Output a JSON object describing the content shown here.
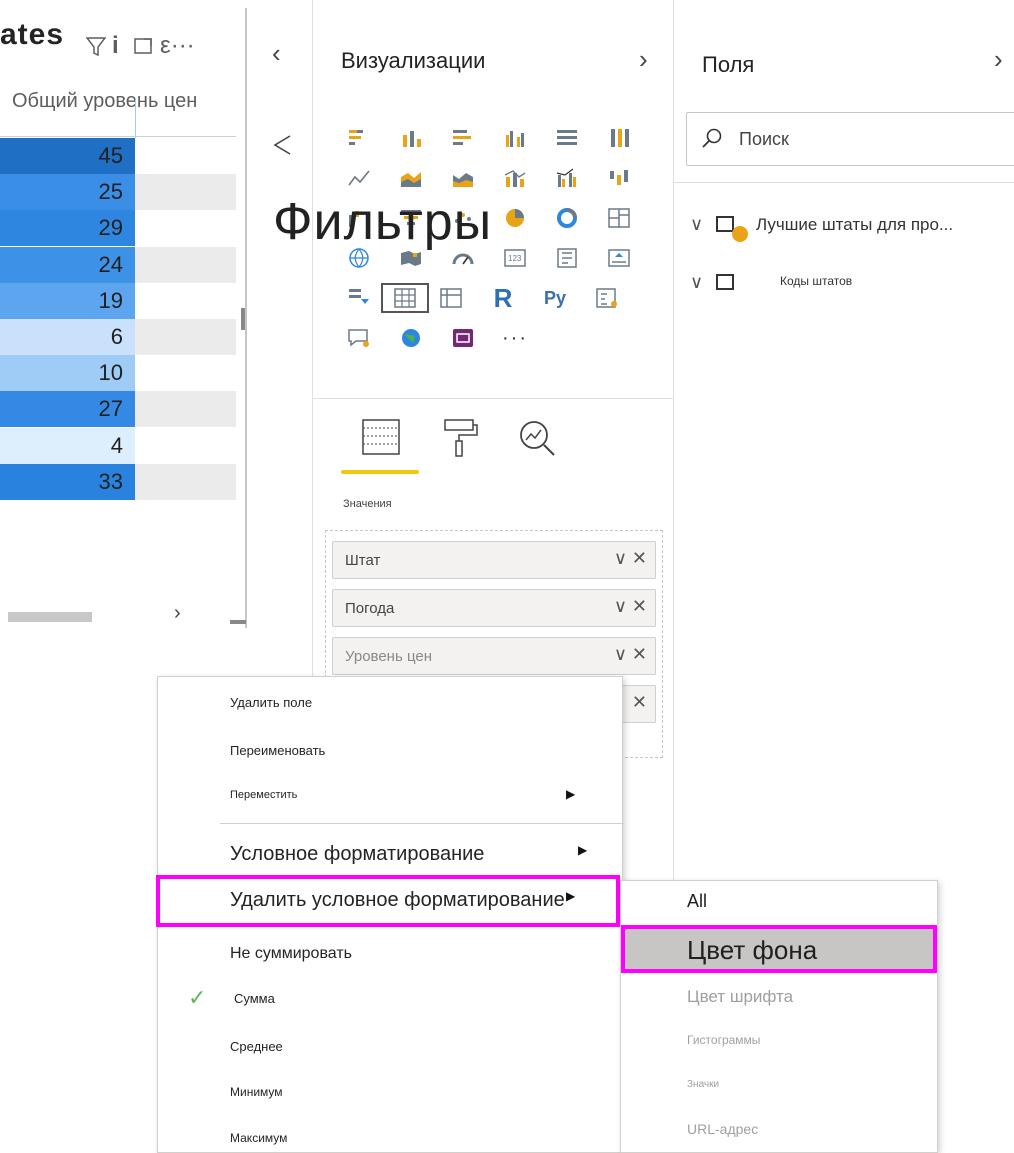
{
  "table_visual": {
    "title": "ates",
    "title_icons": [
      "filter-icon",
      "info-icon",
      "focus-mode-icon",
      "more-options-icon"
    ],
    "column_header": "Общий уровень цен",
    "rows": [
      {
        "value": "45",
        "color": "#1f6fc5"
      },
      {
        "value": "25",
        "color": "#3a8ee6"
      },
      {
        "value": "29",
        "color": "#2f86e0"
      },
      {
        "value": "24",
        "color": "#3d91e7"
      },
      {
        "value": "19",
        "color": "#5ea5ef"
      },
      {
        "value": "6",
        "color": "#c9e1fb"
      },
      {
        "value": "10",
        "color": "#9fcbf7"
      },
      {
        "value": "27",
        "color": "#3389e3"
      },
      {
        "value": "4",
        "color": "#ddeefd"
      },
      {
        "value": "33",
        "color": "#2a82df"
      }
    ]
  },
  "overlay": {
    "filters_label": "Фильтры"
  },
  "visualizations": {
    "title": "Визуализации",
    "values_label": "Значения",
    "wells": [
      {
        "label": "Штат"
      },
      {
        "label": "Погода"
      },
      {
        "label": "Уровень цен"
      },
      {
        "label": ""
      }
    ]
  },
  "fields": {
    "title": "Поля",
    "search_placeholder": "Поиск",
    "tables": [
      {
        "name": "Лучшие штаты для про..."
      },
      {
        "name": "Коды штатов"
      }
    ]
  },
  "context_menu": {
    "items": {
      "delete_field": "Удалить поле",
      "rename": "Переименовать",
      "move": "Переместить",
      "conditional_formatting": "Условное форматирование",
      "remove_conditional_formatting": "Удалить условное форматирование",
      "dont_summarize": "Не суммировать",
      "sum": "Сумма",
      "average": "Среднее",
      "minimum": "Минимум",
      "maximum": "Максимум"
    }
  },
  "sub_menu": {
    "all": "All",
    "background_color": "Цвет фона",
    "font_color": "Цвет шрифта",
    "data_bars": "Гистограммы",
    "icons": "Значки",
    "web_url": "URL-адрес"
  },
  "colors": {
    "highlight": "#ff00ff",
    "accent_underline": "#f2c811"
  }
}
